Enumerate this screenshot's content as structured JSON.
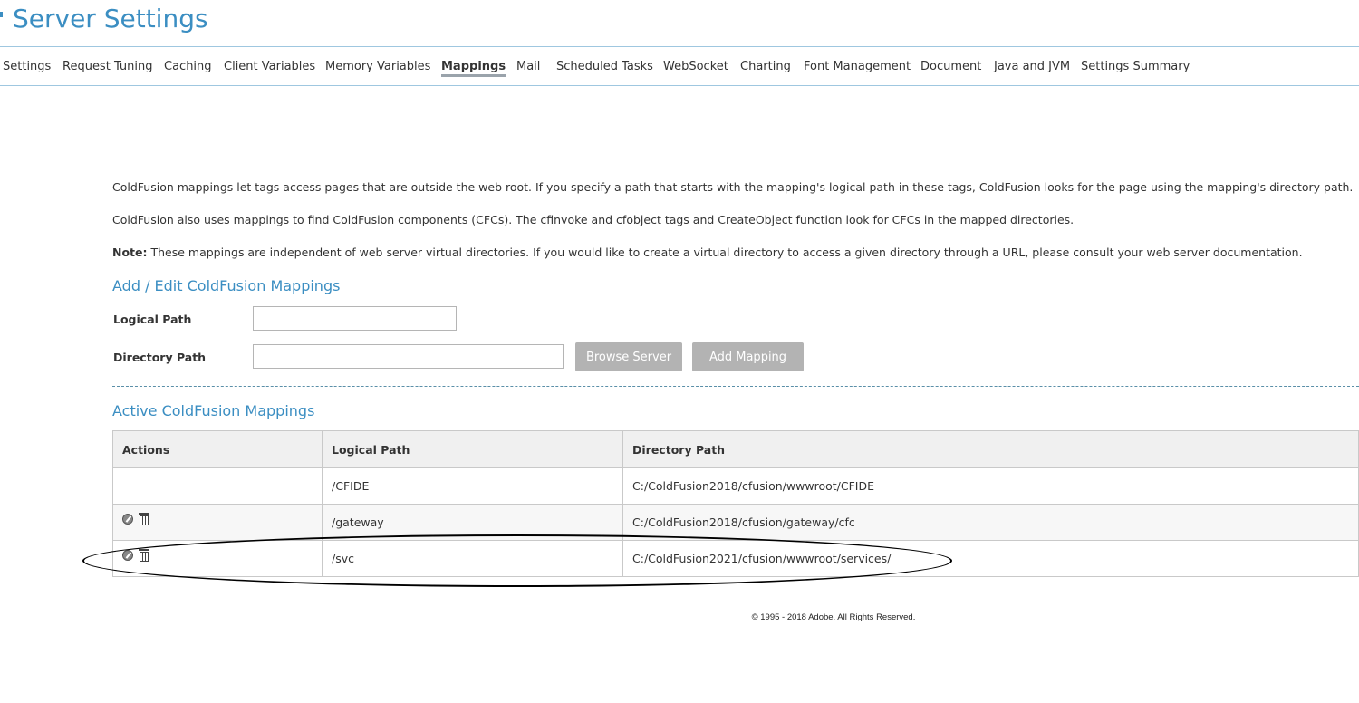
{
  "header": {
    "title": "Server Settings"
  },
  "tabs": [
    {
      "label": "Settings"
    },
    {
      "label": "Request Tuning"
    },
    {
      "label": "Caching"
    },
    {
      "label": "Client Variables"
    },
    {
      "label": "Memory Variables"
    },
    {
      "label": "Mappings",
      "active": true
    },
    {
      "label": "Mail"
    },
    {
      "label": "Scheduled Tasks"
    },
    {
      "label": "WebSocket"
    },
    {
      "label": "Charting"
    },
    {
      "label": "Font Management"
    },
    {
      "label": "Document"
    },
    {
      "label": "Java and JVM"
    },
    {
      "label": "Settings Summary"
    }
  ],
  "intro": {
    "p1": "ColdFusion mappings let tags access pages that are outside the web root. If you specify a path that starts with the mapping's logical path in these tags, ColdFusion looks for the page using the mapping's directory path.",
    "p2": "ColdFusion also uses mappings to find ColdFusion components (CFCs). The cfinvoke and cfobject tags and CreateObject function look for CFCs in the mapped directories.",
    "note_label": "Note:",
    "note_text": " These mappings are independent of web server virtual directories. If you would like to create a virtual directory to access a given directory through a URL, please consult your web server documentation."
  },
  "form": {
    "heading": "Add / Edit ColdFusion Mappings",
    "logical_path_label": "Logical Path",
    "logical_path_value": "",
    "directory_path_label": "Directory Path",
    "directory_path_value": "",
    "browse_button": "Browse Server",
    "add_button": "Add Mapping"
  },
  "active": {
    "heading": "Active ColdFusion Mappings",
    "columns": [
      "Actions",
      "Logical Path",
      "Directory Path"
    ],
    "rows": [
      {
        "logical": "/CFIDE",
        "directory": "C:/ColdFusion2018/cfusion/wwwroot/CFIDE",
        "editable": false
      },
      {
        "logical": "/gateway",
        "directory": "C:/ColdFusion2018/cfusion/gateway/cfc",
        "editable": true
      },
      {
        "logical": "/svc",
        "directory": "C:/ColdFusion2021/cfusion/wwwroot/services/",
        "editable": true
      }
    ],
    "icons": {
      "edit": "edit-icon",
      "delete": "trash-icon"
    }
  },
  "footer": {
    "copyright": "© 1995 - 2018 Adobe. All Rights Reserved."
  }
}
